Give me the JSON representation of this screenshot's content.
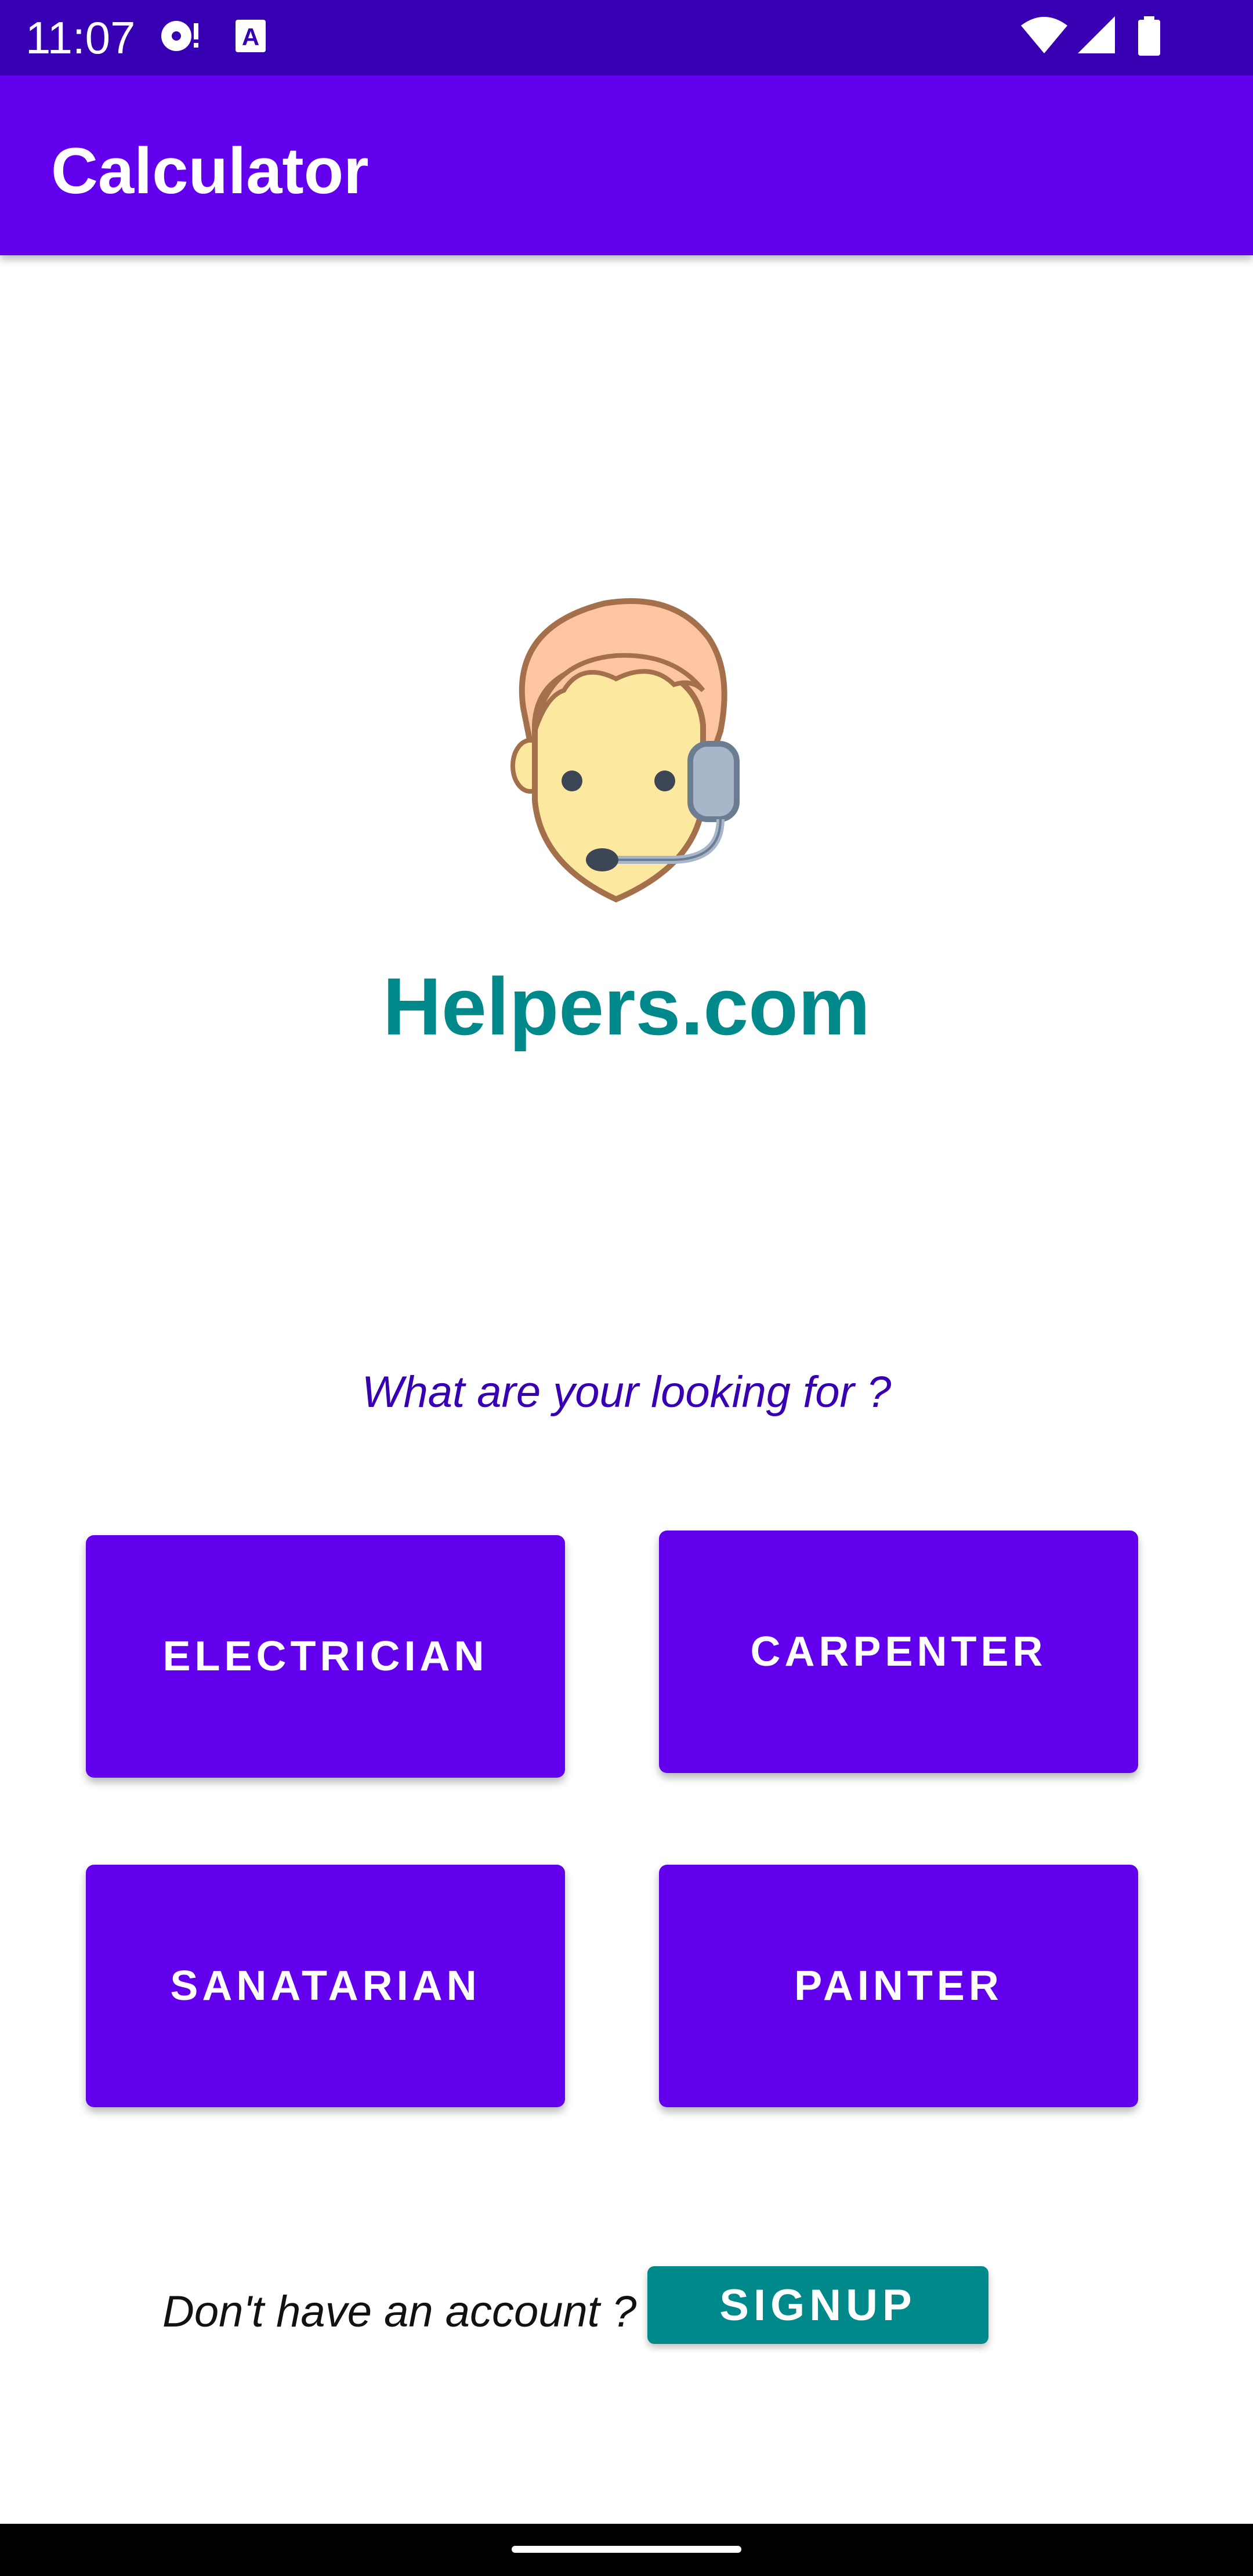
{
  "status_bar": {
    "time": "11:07",
    "icons": [
      "sync-disc-icon",
      "font-a-icon",
      "wifi-icon",
      "signal-icon",
      "battery-icon"
    ],
    "background": "#3700b3"
  },
  "app_bar": {
    "title": "Calculator",
    "background": "#6200ee"
  },
  "main": {
    "logo_icon": "support-agent-headset-icon",
    "brand": "Helpers.com",
    "brand_color": "#00898a",
    "prompt": "What are your looking for ?",
    "services": [
      {
        "label": "ELECTRICIAN"
      },
      {
        "label": "CARPENTER"
      },
      {
        "label": "SANATARIAN"
      },
      {
        "label": "PAINTER"
      }
    ],
    "button_color": "#6200ee"
  },
  "footer": {
    "question": "Don't have an account ?",
    "signup_label": "SIGNUP",
    "signup_color": "#00898a"
  },
  "nav_bar": {
    "home_indicator": "home-gesture-bar"
  }
}
